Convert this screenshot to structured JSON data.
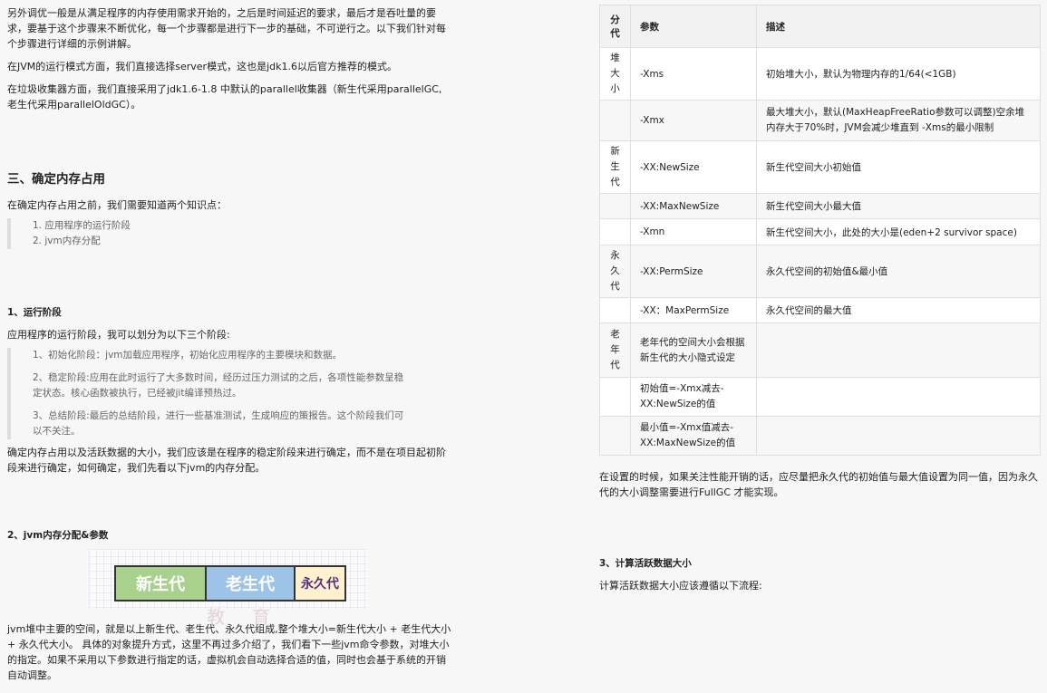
{
  "left": {
    "intro_p1": "另外调优一般是从满足程序的内存使用需求开始的，之后是时间延迟的要求，最后才是吞吐量的要求，要基于这个步骤来不断优化，每一个步骤都是进行下一步的基础，不可逆行之。以下我们针对每个步骤进行详细的示例讲解。",
    "intro_p2": "在JVM的运行模式方面，我们直接选择server模式，这也是jdk1.6以后官方推荐的模式。",
    "intro_p3": "在垃圾收集器方面，我们直接采用了jdk1.6-1.8 中默认的parallel收集器（新生代采用parallelGC,老生代采用parallelOldGC）。",
    "h_section3": "三、确定内存占用",
    "s3_intro": "在确定内存占用之前，我们需要知道两个知识点：",
    "s3_list": [
      "1. 应用程序的运行阶段",
      "2. jvm内存分配"
    ],
    "h_run_stage": "1、运行阶段",
    "run_intro": "应用程序的运行阶段，我可以划分为以下三个阶段:",
    "run_list": [
      "1、初始化阶段：jvm加载应用程序，初始化应用程序的主要模块和数据。",
      "2、稳定阶段:应用在此时运行了大多数时间，经历过压力测试的之后，各项性能参数呈稳定状态。核心函数被执行，已经被jit编译预热过。",
      "3、总结阶段:最后的总结阶段，进行一些基准测试，生成响应的策报告。这个阶段我们可以不关注。"
    ],
    "run_after": "确定内存占用以及活跃数据的大小，我们应该是在程序的稳定阶段来进行确定，而不是在项目起初阶段来进行确定，如何确定，我们先看以下jvm的内存分配。",
    "h_mem_alloc": "2、jvm内存分配&参数",
    "diagram": {
      "young": "新生代",
      "old": "老生代",
      "perm": "永久代",
      "watermark": "马士兵教育"
    },
    "mem_desc": "jvm堆中主要的空间，就是以上新生代、老生代、永久代组成,整个堆大小=新生代大小 + 老生代大小 + 永久代大小。 具体的对象提升方式，这里不再过多介绍了，我们看下一些jvm命令参数，对堆大小的指定。如果不采用以下参数进行指定的话，虚拟机会自动选择合适的值，同时也会基于系统的开销自动调整。"
  },
  "right": {
    "table_headers": [
      "分代",
      "参数",
      "描述"
    ],
    "rows": [
      {
        "gen": "堆大小",
        "param": "-Xms",
        "desc": "初始堆大小，默认为物理内存的1/64(<1GB)"
      },
      {
        "gen": "",
        "param": "-Xmx",
        "desc": "最大堆大小，默认(MaxHeapFreeRatio参数可以调整)空余堆内存大于70%时，JVM会减少堆直到 -Xms的最小限制"
      },
      {
        "gen": "新生代",
        "param": "-XX:NewSize",
        "desc": "新生代空间大小初始值"
      },
      {
        "gen": "",
        "param": "-XX:MaxNewSize",
        "desc": "新生代空间大小最大值"
      },
      {
        "gen": "",
        "param": "-Xmn",
        "desc": "新生代空间大小，此处的大小是(eden+2 survivor space)"
      },
      {
        "gen": "永久代",
        "param": "-XX:PermSize",
        "desc": "永久代空间的初始值&最小值"
      },
      {
        "gen": "",
        "param": "-XX：MaxPermSize",
        "desc": "永久代空间的最大值"
      },
      {
        "gen": "老年代",
        "param": "老年代的空间大小会根据新生代的大小隐式设定",
        "desc": ""
      },
      {
        "gen": "",
        "param": "初始值=-Xmx减去-XX:NewSize的值",
        "desc": ""
      },
      {
        "gen": "",
        "param": "最小值=-Xmx值减去-XX:MaxNewSize的值",
        "desc": ""
      }
    ],
    "after_table": "在设置的时候，如果关注性能开销的话，应尽量把永久代的初始值与最大值设置为同一值，因为永久代的大小调整需要进行FullGC 才能实现。",
    "h_active": "3、计算活跃数据大小",
    "active_intro": "计算活跃数据大小应该遵循以下流程:"
  }
}
